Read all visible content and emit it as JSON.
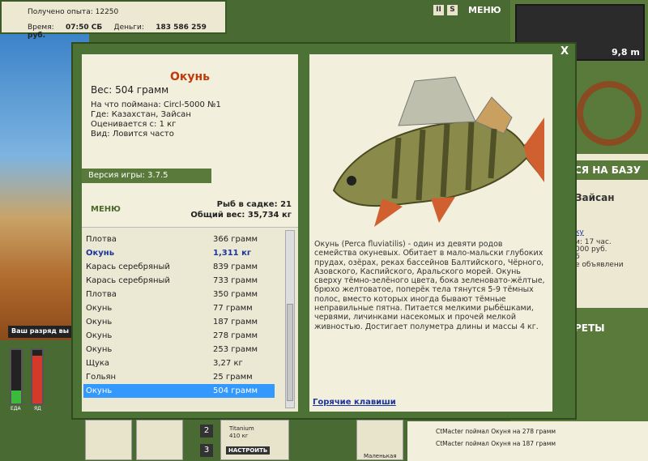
{
  "topbar": {
    "experience_label": "Получено опыта:",
    "experience_value": "12250",
    "time_label": "Время:",
    "time_value": "07:50 СБ",
    "money_label": "Деньги:",
    "money_value": "183 586 259 руб."
  },
  "top_menu": {
    "pause": "II",
    "sound": "S",
    "menu": "МЕНЮ"
  },
  "depth": "9,8 m",
  "dialog": {
    "close": "X",
    "fish_name": "Окунь",
    "weight_line": "Вес: 504 грамм",
    "caught_on": "На что поймана: Circl-5000 №1",
    "location": "Где: Казахстан, Зайсан",
    "valued_from": "Оценивается с: 1 кг",
    "type_line": "Вид: Ловится часто",
    "version": "Версия игры: 3.7.5",
    "menu_button": "МЕНЮ",
    "fish_in_keepnet": "Рыб в садке: 21",
    "total_weight": "Общий вес: 35,734 кг",
    "catch_list": [
      {
        "name": "Плотва",
        "weight": "366 грамм"
      },
      {
        "name": "Окунь",
        "weight": "1,311 кг",
        "highlight": true
      },
      {
        "name": "Карась серебряный",
        "weight": "839 грамм"
      },
      {
        "name": "Карась серебряный",
        "weight": "733 грамм"
      },
      {
        "name": "Плотва",
        "weight": "350 грамм"
      },
      {
        "name": "Окунь",
        "weight": "77 грамм"
      },
      {
        "name": "Окунь",
        "weight": "187 грамм"
      },
      {
        "name": "Окунь",
        "weight": "278 грамм"
      },
      {
        "name": "Окунь",
        "weight": "253 грамм"
      },
      {
        "name": "Щука",
        "weight": "3,27 кг"
      },
      {
        "name": "Гольян",
        "weight": "25 грамм"
      },
      {
        "name": "Окунь",
        "weight": "504 грамм",
        "selected": true
      }
    ],
    "description": "Окунь (Perca fluviatilis) - один из девяти родов семейства окуневых. Обитает в мало-мальски глубоких прудах, озёрах, реках бассейнов Балтийского, Чёрного, Азовского, Каспийского, Аральского морей. Окунь сверху тёмно-зелёного цвета, бока зеленовато-жёлтые, брюхо желтоватое, поперёк тела тянутся 5-9 тёмных полос, вместо которых иногда бывают тёмные неправильные пятна. Питается мелкими рыбёшками, червями, личинками насекомых и прочей мелкой живностью. Достигает полуметра длины и массы 4 кг.",
    "hotkeys": "Горячие клавиши"
  },
  "right_panel": {
    "banner_base": "СЯ НА БАЗУ",
    "location_short": "Зайсан",
    "line1": "ку",
    "line2": "и: 17 час.",
    "line3": "000 руб.",
    "line4": "6",
    "line5": "е объявлени",
    "banner_secrets": "РЕТЫ"
  },
  "rank": "Ваш разряд вы",
  "meters": {
    "left_label": "ЕДА",
    "right_label": "ЯД",
    "left_level": 0.25,
    "right_level": 0.9
  },
  "bottom": {
    "slot2": "2",
    "slot3": "3",
    "titanium": "Titanium",
    "titanium_weight": "410 кг",
    "setup_button": "НАСТРОИТЬ",
    "small_label": "Маленькая",
    "log": [
      "CtMacter поймал Окуня на 278 грамм",
      "CtMacter поймал Окуня на 187 грамм"
    ]
  }
}
